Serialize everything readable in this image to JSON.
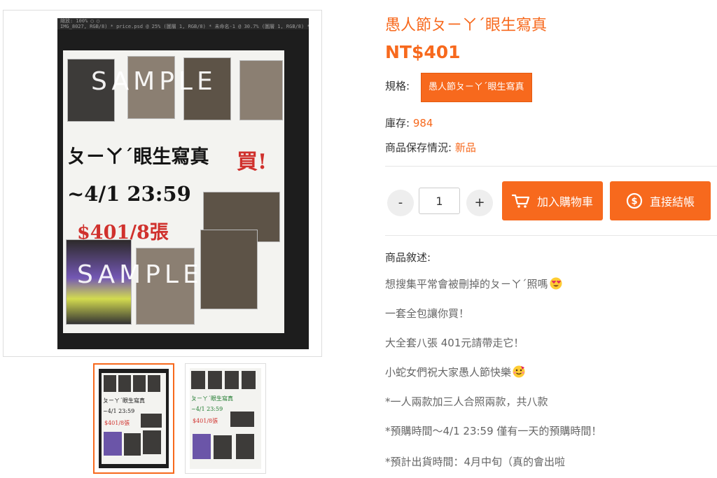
{
  "product": {
    "title": "愚人節ㄆㄧㄚˊ眼生寫真",
    "price": "NT$401",
    "spec_label": "規格:",
    "spec_option": "愚人節ㄆㄧㄚˊ眼生寫真",
    "stock_label": "庫存:",
    "stock_value": "984",
    "condition_label": "商品保存情況:",
    "condition_value": "新品",
    "accent_color": "#f7691d"
  },
  "quantity": {
    "minus": "-",
    "value": "1",
    "plus": "+"
  },
  "actions": {
    "add_to_cart": "加入購物車",
    "add_to_cart_icon": "cart-icon",
    "buy_now": "直接結帳",
    "buy_now_icon": "dollar-coin-icon"
  },
  "description": {
    "label": "商品敘述:",
    "lines": [
      "想搜集平常會被刪掉的ㄆㄧㄚˊ照嗎",
      "一套全包讓你買！",
      "大全套八張 401元請帶走它！",
      "小蛇女們祝大家愚人節快樂",
      "*一人兩款加三人合照兩款，共八款",
      "*預購時間～4/1 23:59 僅有一天的預購時間！",
      "*預計出貨時間：4月中旬（真的會出啦"
    ],
    "line1_emoji": "heart-eyes-emoji",
    "line4_emoji": "party-face-emoji"
  },
  "gallery": {
    "photo_header": "縮放: 100%    ◯ ◯",
    "photo_tabs": "IMG_8027, RGB/8) *    price.psd @ 25% (圖層 1, RGB/8) *    未命名-1 @ 30.7% (圖層 1, RGB/8) *",
    "poster_watermark": "SAMPLE",
    "poster_title": "ㄆㄧㄚˊ眼生寫真",
    "poster_date": "~4/1 23:59",
    "poster_price": "$401/8張",
    "poster_buy": "買!",
    "thumb_count": 2
  }
}
